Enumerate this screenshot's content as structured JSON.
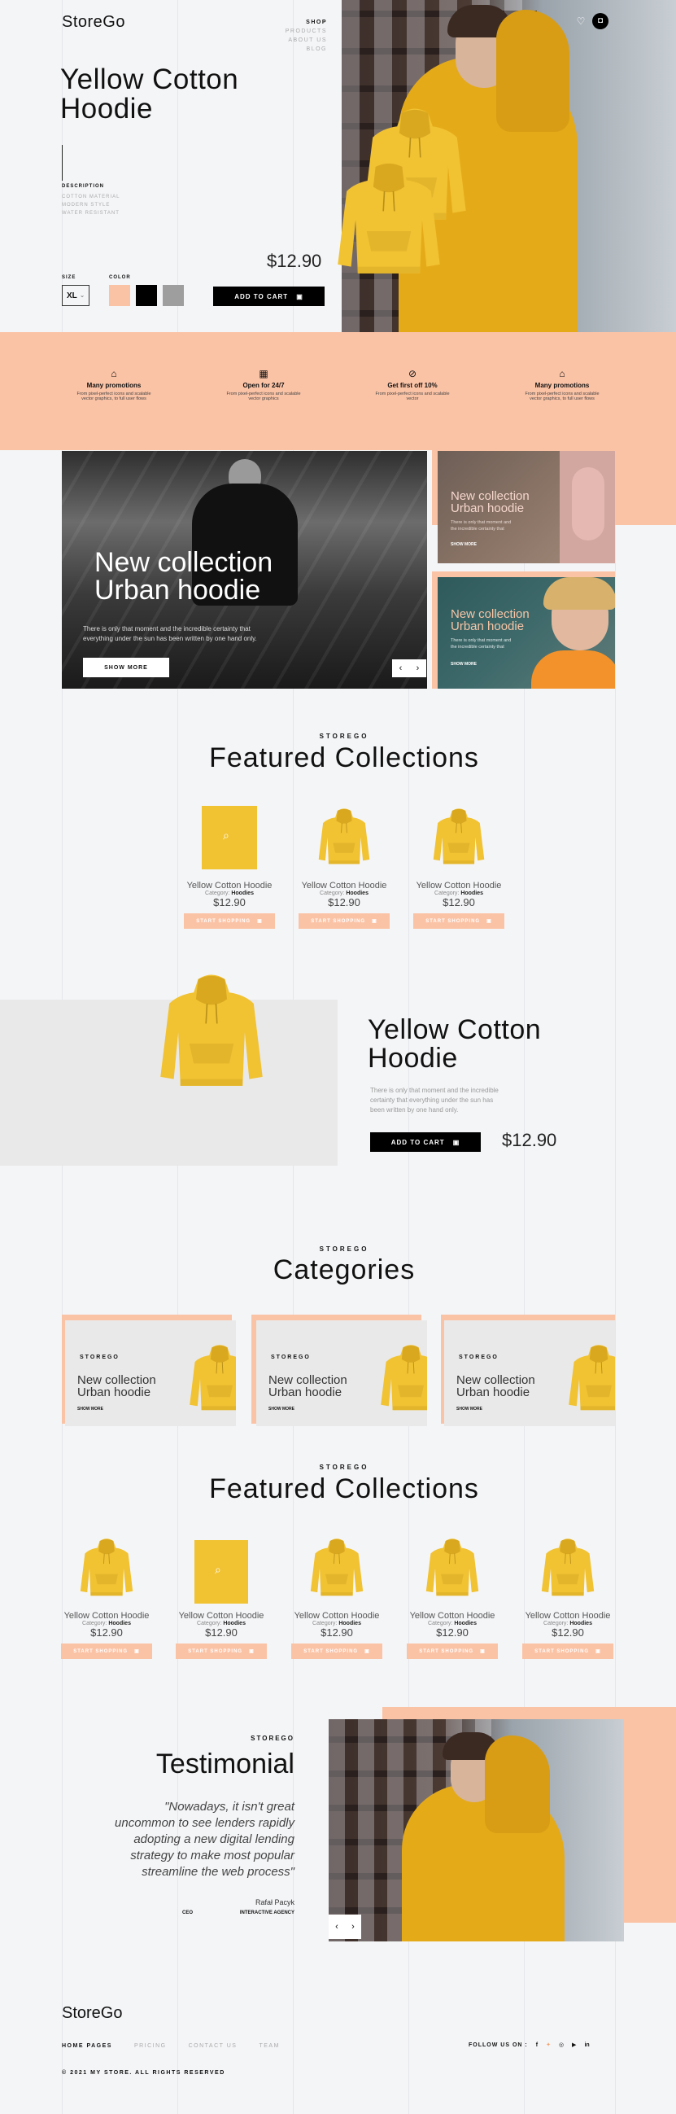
{
  "brand": "StoreGo",
  "nav": {
    "items": [
      "SHOP",
      "PRODUCTS",
      "ABOUT US",
      "BLOG"
    ]
  },
  "hero": {
    "title_line1": "Yellow Cotton",
    "title_line2": "Hoodie",
    "description_label": "DESCRIPTION",
    "description_lines": [
      "COTTON MATERIAL",
      "MODERN STYLE",
      "WATER RESISTANT"
    ],
    "size_label": "SIZE",
    "size_value": "XL",
    "color_label": "COLOR",
    "colors": [
      "#fbc3a6",
      "#000000",
      "#9e9e9e"
    ],
    "price": "$12.90",
    "add_to_cart": "ADD TO CART"
  },
  "features": [
    {
      "title": "Many promotions",
      "text1": "From pixel-perfect icons and scalable",
      "text2": "vector graphics, to full user flows",
      "icon": "tag-icon"
    },
    {
      "title": "Open for 24/7",
      "text1": "From pixel-perfect icons and scalable",
      "text2": "vector graphics",
      "icon": "shop-icon"
    },
    {
      "title": "Get first off 10%",
      "text1": "From pixel-perfect icons and scalable",
      "text2": "vector",
      "icon": "percent-icon"
    },
    {
      "title": "Many promotions",
      "text1": "From pixel-perfect icons and scalable",
      "text2": "vector graphics, to full user flows",
      "icon": "tag-icon"
    }
  ],
  "promo_main": {
    "title1": "New collection",
    "title2": "Urban hoodie",
    "text1": "There is only that moment and the incredible certainty that",
    "text2": "everything under the sun has been written by one hand only.",
    "button": "SHOW MORE"
  },
  "promo_side": [
    {
      "title1": "New collection",
      "title2": "Urban hoodie",
      "text1": "There is only that moment and",
      "text2": "the incredible certainty that",
      "button": "SHOW MORE"
    },
    {
      "title1": "New collection",
      "title2": "Urban hoodie",
      "text1": "There is only that moment and",
      "text2": "the incredible certainty that",
      "button": "SHOW MORE"
    }
  ],
  "featured1": {
    "kicker": "STOREGO",
    "title": "Featured Collections",
    "items": [
      {
        "name": "Yellow Cotton Hoodie",
        "category_label": "Category:",
        "category": "Hoodies",
        "price": "$12.90",
        "button": "START SHOPPING"
      },
      {
        "name": "Yellow Cotton Hoodie",
        "category_label": "Category:",
        "category": "Hoodies",
        "price": "$12.90",
        "button": "START SHOPPING"
      },
      {
        "name": "Yellow Cotton Hoodie",
        "category_label": "Category:",
        "category": "Hoodies",
        "price": "$12.90",
        "button": "START SHOPPING"
      }
    ]
  },
  "product2": {
    "title_line1": "Yellow Cotton",
    "title_line2": "Hoodie",
    "text1": "There is only that moment and the incredible",
    "text2": "certainty that everything under the sun has",
    "text3": "been written by one hand only.",
    "add_to_cart": "ADD TO CART",
    "price": "$12.90"
  },
  "categories": {
    "kicker": "STOREGO",
    "title": "Categories",
    "items": [
      {
        "kicker": "STOREGO",
        "title1": "New collection",
        "title2": "Urban hoodie",
        "button": "SHOW MORE"
      },
      {
        "kicker": "STOREGO",
        "title1": "New collection",
        "title2": "Urban hoodie",
        "button": "SHOW MORE"
      },
      {
        "kicker": "STOREGO",
        "title1": "New collection",
        "title2": "Urban hoodie",
        "button": "SHOW MORE"
      }
    ]
  },
  "featured2": {
    "kicker": "STOREGO",
    "title": "Featured Collections",
    "items": [
      {
        "name": "Yellow Cotton Hoodie",
        "category_label": "Category:",
        "category": "Hoodies",
        "price": "$12.90",
        "button": "START SHOPPING"
      },
      {
        "name": "Yellow Cotton Hoodie",
        "category_label": "Category:",
        "category": "Hoodies",
        "price": "$12.90",
        "button": "START SHOPPING"
      },
      {
        "name": "Yellow Cotton Hoodie",
        "category_label": "Category:",
        "category": "Hoodies",
        "price": "$12.90",
        "button": "START SHOPPING"
      },
      {
        "name": "Yellow Cotton Hoodie",
        "category_label": "Category:",
        "category": "Hoodies",
        "price": "$12.90",
        "button": "START SHOPPING"
      },
      {
        "name": "Yellow Cotton Hoodie",
        "category_label": "Category:",
        "category": "Hoodies",
        "price": "$12.90",
        "button": "START SHOPPING"
      }
    ]
  },
  "testimonial": {
    "kicker": "STOREGO",
    "title": "Testimonial",
    "quote_lines": [
      "\"Nowadays, it isn't great",
      "uncommon to see lenders rapidly",
      "adopting a new digital lending",
      "strategy to make most  popular",
      "streamline the web process\""
    ],
    "author": "Rafał Pacyk",
    "role": "CEO",
    "company": "INTERACTIVE AGENCY"
  },
  "footer": {
    "brand": "StoreGo",
    "links": [
      "HOME PAGES",
      "PRICING",
      "CONTACT US",
      "TEAM"
    ],
    "follow": "FOLLOW US ON :",
    "copyright": "© 2021 MY STORE. ALL RIGHTS RESERVED"
  },
  "colors": {
    "peach": "#fbc3a6",
    "yellow": "#f1c232",
    "black": "#000000"
  }
}
